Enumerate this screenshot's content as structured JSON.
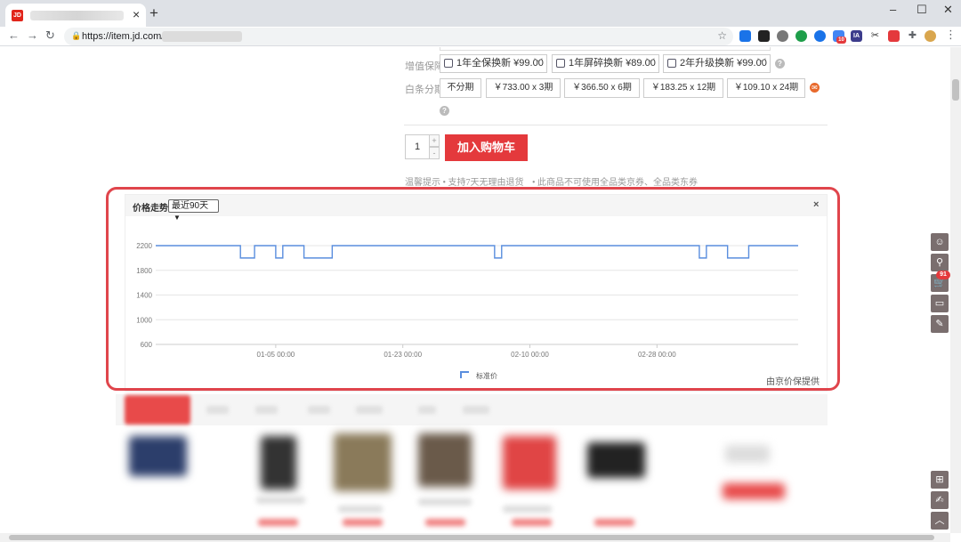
{
  "tab": {
    "favicon": "JD",
    "close": "×",
    "new_tab": "+"
  },
  "window": {
    "minimize": "–",
    "maximize": "☐",
    "close": "✕"
  },
  "toolbar": {
    "back": "←",
    "forward": "→",
    "reload": "↻",
    "url": "https://item.jd.com/",
    "menu": "⋮"
  },
  "extensions": {
    "ia_label": "IA",
    "badge_count": "10"
  },
  "services": {
    "label": "增值保障",
    "options": [
      "1年全保换新 ¥99.00",
      "1年屏碎换新 ¥89.00",
      "2年升级换新 ¥99.00"
    ]
  },
  "installment": {
    "label": "白条分期",
    "options": [
      "不分期",
      "￥733.00 x 3期",
      "￥366.50 x 6期",
      "￥183.25 x 12期",
      "￥109.10 x 24期"
    ]
  },
  "cart": {
    "quantity": "1",
    "plus": "+",
    "minus": "-",
    "add_label": "加入购物车"
  },
  "tips": {
    "line1": "温馨提示 • 支持7天无理由退货",
    "line2": "• 此商品不可使用全品类京券、全品类东券"
  },
  "price_widget": {
    "title": "价格走势",
    "range": "最近90天",
    "close": "×",
    "provider": "由京价保提供"
  },
  "colors": {
    "accent": "#e4393c",
    "series": "#5a8ede",
    "highlight": "#e0454c"
  },
  "sidebar": {
    "cart_badge": "91"
  },
  "chart_data": {
    "type": "line",
    "step": true,
    "series": [
      {
        "name": "标准价",
        "x": [
          "2020-12-19",
          "2020-12-31",
          "2021-01-02",
          "2021-01-05",
          "2021-01-06",
          "2021-01-07",
          "2021-01-09",
          "2021-01-12",
          "2021-01-13",
          "2021-02-05",
          "2021-02-06",
          "2021-03-06",
          "2021-03-07",
          "2021-03-09",
          "2021-03-10",
          "2021-03-12",
          "2021-03-13",
          "2021-03-20"
        ],
        "values": [
          2200,
          2000,
          2200,
          2000,
          2200,
          2200,
          2000,
          2000,
          2200,
          2000,
          2200,
          2000,
          2200,
          2200,
          2000,
          2000,
          2200,
          2200
        ]
      }
    ],
    "ylim": [
      600,
      2200
    ],
    "yticks": [
      "2200",
      "1800",
      "1400",
      "1000",
      "600"
    ],
    "xticks": [
      "01-05 00:00",
      "01-23 00:00",
      "02-10 00:00",
      "02-28 00:00"
    ],
    "xtick_dates": [
      "2021-01-05",
      "2021-01-23",
      "2021-02-10",
      "2021-02-28"
    ],
    "xrange": [
      "2020-12-19",
      "2021-03-20"
    ],
    "grid": true,
    "legend": "bottom"
  }
}
